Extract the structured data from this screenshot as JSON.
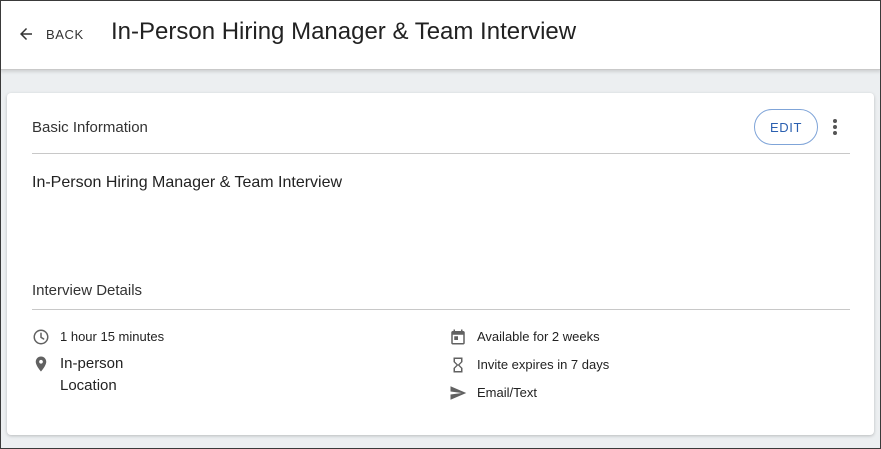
{
  "header": {
    "back_label": "BACK",
    "title": "In-Person Hiring Manager & Team Interview"
  },
  "basic_info": {
    "section_title": "Basic Information",
    "edit_label": "EDIT",
    "interview_name": "In-Person Hiring Manager & Team Interview"
  },
  "interview_details": {
    "section_title": "Interview Details",
    "duration": "1 hour 15 minutes",
    "location_type_line1": "In-person",
    "location_type_line2": "Location",
    "availability": "Available for 2 weeks",
    "invite_expiry": "Invite expires in 7 days",
    "delivery_method": "Email/Text"
  },
  "colors": {
    "accent": "#2a5fb0",
    "edit_border": "#7fa4d8",
    "background": "#eceff1",
    "icon": "#616161"
  }
}
